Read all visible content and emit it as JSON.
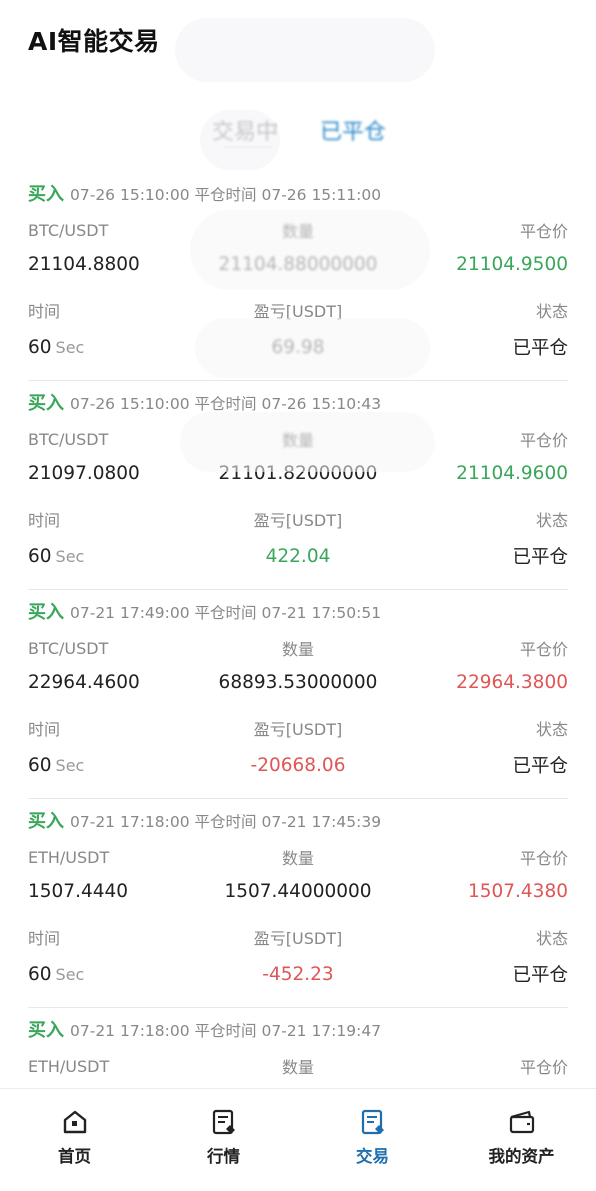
{
  "header": {
    "title": "AI智能交易"
  },
  "tabs": [
    {
      "label": "交易中",
      "active": false
    },
    {
      "label": "已平仓",
      "active": true
    }
  ],
  "labels": {
    "buy": "买入",
    "close_time": "平仓时间",
    "time": "时间",
    "pnl": "盈亏[USDT]",
    "close_price": "平仓价",
    "status": "状态",
    "sec_unit": "Sec"
  },
  "orders": [
    {
      "side": "买入",
      "open_time": "07-26 15:10:00",
      "close_time": "07-26 15:11:00",
      "pair": "BTC/USDT",
      "qty_label": "数量",
      "open_price": "21104.8800",
      "qty": "21104.88000000",
      "close_price": "21104.9500",
      "close_price_color": "#3aa65a",
      "duration": "60",
      "pnl": "69.98",
      "pnl_color": "#3aa65a",
      "status": "已平仓"
    },
    {
      "side": "买入",
      "open_time": "07-26 15:10:00",
      "close_time": "07-26 15:10:43",
      "pair": "BTC/USDT",
      "qty_label": "数量",
      "open_price": "21097.0800",
      "qty": "21101.82000000",
      "close_price": "21104.9600",
      "close_price_color": "#3aa65a",
      "duration": "60",
      "pnl": "422.04",
      "pnl_color": "#3aa65a",
      "status": "已平仓"
    },
    {
      "side": "买入",
      "open_time": "07-21 17:49:00",
      "close_time": "07-21 17:50:51",
      "pair": "BTC/USDT",
      "qty_label": "数量",
      "open_price": "22964.4600",
      "qty": "68893.53000000",
      "close_price": "22964.3800",
      "close_price_color": "#e05656",
      "duration": "60",
      "pnl": "-20668.06",
      "pnl_color": "#e05656",
      "status": "已平仓"
    },
    {
      "side": "买入",
      "open_time": "07-21 17:18:00",
      "close_time": "07-21 17:45:39",
      "pair": "ETH/USDT",
      "qty_label": "数量",
      "open_price": "1507.4440",
      "qty": "1507.44000000",
      "close_price": "1507.4380",
      "close_price_color": "#e05656",
      "duration": "60",
      "pnl": "-452.23",
      "pnl_color": "#e05656",
      "status": "已平仓"
    },
    {
      "side": "买入",
      "open_time": "07-21 17:18:00",
      "close_time": "07-21 17:19:47",
      "pair": "ETH/USDT",
      "qty_label": "数量",
      "open_price": "",
      "qty": "",
      "close_price": "",
      "close_price_color": "#222222",
      "duration": "",
      "pnl": "",
      "pnl_color": "#222222",
      "status": ""
    }
  ],
  "nav": [
    {
      "label": "首页",
      "icon": "home-icon",
      "active": false
    },
    {
      "label": "行情",
      "icon": "market-icon",
      "active": false
    },
    {
      "label": "交易",
      "icon": "trade-icon",
      "active": true
    },
    {
      "label": "我的资产",
      "icon": "wallet-icon",
      "active": false
    }
  ],
  "colors": {
    "buy": "#3aa65a",
    "profit": "#3aa65a",
    "loss": "#e05656",
    "active_tab": "#2a88c8",
    "active_nav": "#1f6fae"
  }
}
